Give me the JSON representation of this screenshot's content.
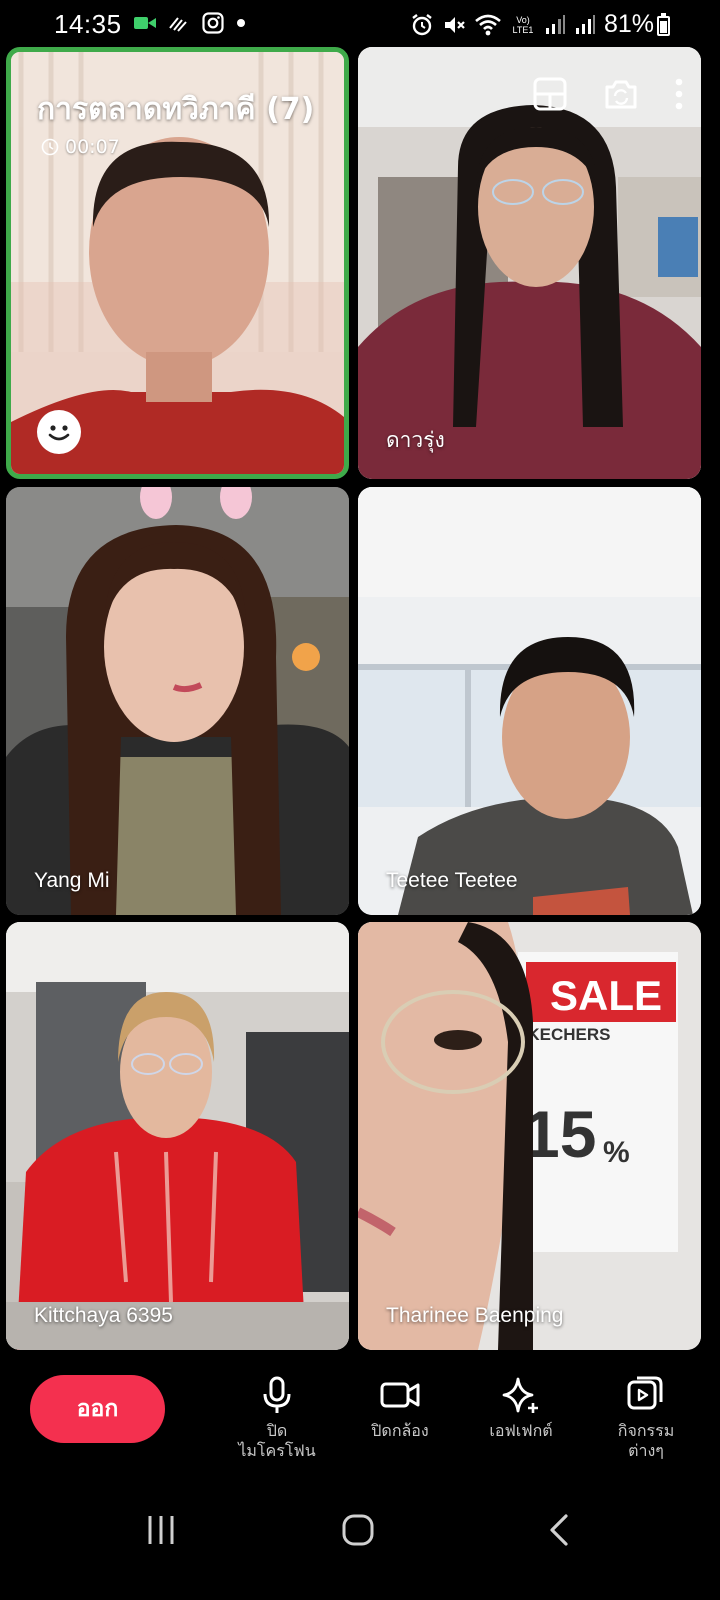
{
  "status_bar": {
    "time": "14:35",
    "battery_percent": "81%",
    "volte_label": "Vo) LTE1",
    "icons": [
      "video-call-icon",
      "wifi-calling-icon",
      "instagram-icon",
      "dot-icon",
      "alarm-icon",
      "mute-icon",
      "wifi-icon",
      "signal-icon",
      "battery-icon"
    ]
  },
  "call": {
    "group_title": "การตลาดทวิภาคี  (7)",
    "duration": "00:07",
    "participants": [
      {
        "name": ""
      },
      {
        "name": "ดาวรุ่ง"
      },
      {
        "name": "Yang Mi"
      },
      {
        "name": "Teetee Teetee"
      },
      {
        "name": "Kittchaya 6395"
      },
      {
        "name": "Tharinee Baenping"
      }
    ],
    "tile_tools": [
      "layout-icon",
      "switch-camera-icon",
      "more-options-icon"
    ],
    "highlight_color": "#3faa4a"
  },
  "controls": {
    "leave_label": "ออก",
    "leave_color": "#f4304f",
    "mic_label_line1": "ปิด",
    "mic_label_line2": "ไมโครโฟน",
    "camera_label": "ปิดกล้อง",
    "effects_label": "เอฟเฟกต์",
    "activities_label_line1": "กิจกรรม",
    "activities_label_line2": "ต่างๆ"
  },
  "navbar": {
    "icons": [
      "recent-apps-icon",
      "home-icon",
      "back-icon"
    ]
  }
}
